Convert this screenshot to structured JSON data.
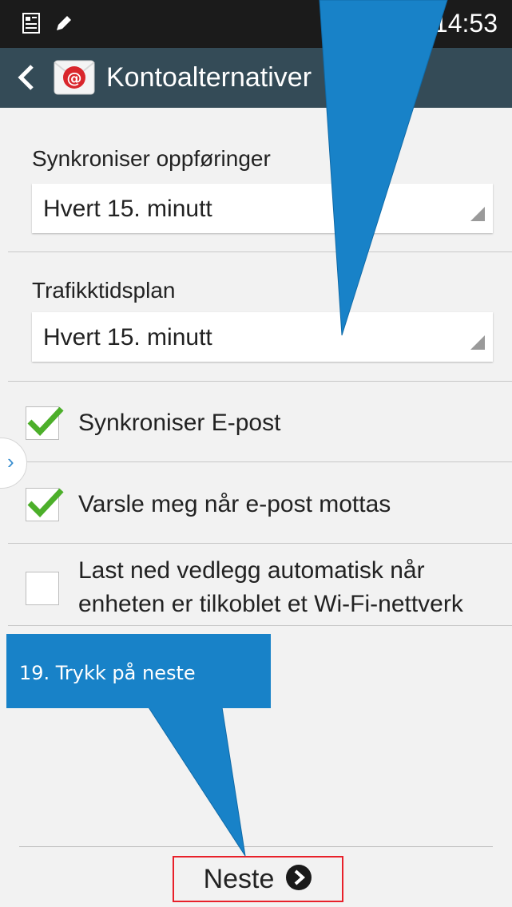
{
  "status_bar": {
    "time": "14:53"
  },
  "action_bar": {
    "title": "Kontoalternativer"
  },
  "sync_schedule": {
    "label": "Synkroniser oppføringer",
    "value": "Hvert 15. minutt"
  },
  "traffic_schedule": {
    "label": "Trafikktidsplan",
    "value": "Hvert 15. minutt"
  },
  "options": [
    {
      "label": "Synkroniser E-post",
      "checked": true
    },
    {
      "label": "Varsle meg når e-post mottas",
      "checked": true
    },
    {
      "label_line1": "Last ned vedlegg automatisk når",
      "label_line2": "enheten er tilkoblet et Wi-Fi-nettverk",
      "checked": false
    }
  ],
  "next_button": {
    "label": "Neste"
  },
  "callout": {
    "text": "19. Trykk på neste"
  },
  "colors": {
    "callout_blue": "#1882c8",
    "highlight_red": "#e8202a",
    "check_green": "#4caf2a",
    "action_bar": "#344b57"
  }
}
